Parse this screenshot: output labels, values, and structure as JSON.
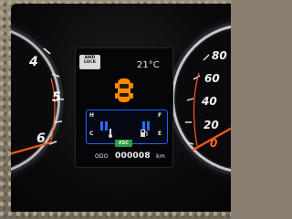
{
  "left_gauge": {
    "numbers": [
      "4",
      "5",
      "6"
    ]
  },
  "right_gauge": {
    "numbers": [
      "80",
      "60",
      "40",
      "20",
      "0"
    ]
  },
  "display": {
    "awd_lock": "AWD LOCK",
    "temperature": "21°C",
    "fuel_h": "H",
    "fuel_f": "F",
    "fuel_c": "C",
    "fuel_e": "E",
    "asc": "ASC",
    "odometer_prefix": "ODO",
    "odometer_value": "000008",
    "odometer_unit": "km"
  },
  "colors": {
    "orange_accent": "#ff6a2a",
    "car_icon": "#ff8a00",
    "frame_blue": "#1a63ff",
    "asc_green": "#2c9b45"
  }
}
